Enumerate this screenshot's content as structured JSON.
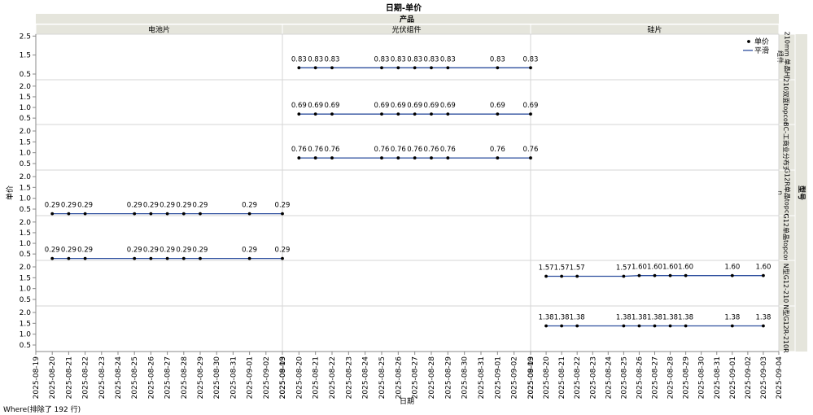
{
  "chart_data": {
    "type": "line",
    "title": "日期-单价",
    "group_header": "产品",
    "row_group_header": "型号",
    "xlabel": "日期",
    "ylabel": "单价",
    "columns": [
      "电池片",
      "光伏组件",
      "硅片"
    ],
    "rows": [
      "210mm 单晶HJT组件",
      "210双面topcon",
      "BC-工商业分布式",
      "G12R单晶topcon",
      "G12单晶topcon",
      "N型G12-210",
      "N型G12R-210R"
    ],
    "x_ticks": [
      "2025-08-19",
      "2025-08-20",
      "2025-08-21",
      "2025-08-22",
      "2025-08-23",
      "2025-08-24",
      "2025-08-25",
      "2025-08-26",
      "2025-08-27",
      "2025-08-28",
      "2025-08-29",
      "2025-08-30",
      "2025-08-31",
      "2025-09-01",
      "2025-09-02",
      "2025-09-03",
      "2025-09-04"
    ],
    "xlim": [
      "2025-08-19",
      "2025-09-03"
    ],
    "xlim_last_panel": [
      "2025-08-19",
      "2025-09-04"
    ],
    "y_axes": [
      {
        "ticks": [
          "2.5",
          "1.5",
          "0.5"
        ],
        "ylim": [
          0.2,
          2.6
        ]
      },
      {
        "ticks": [
          "2.0",
          "1.5",
          "1.0",
          "0.5"
        ],
        "ylim": [
          0.2,
          2.3
        ]
      },
      {
        "ticks": [
          "2.0",
          "1.5",
          "1.0",
          "0.5"
        ],
        "ylim": [
          0.2,
          2.3
        ]
      },
      {
        "ticks": [
          "2.0",
          "1.5",
          "1.0",
          "0.5"
        ],
        "ylim": [
          0.2,
          2.3
        ]
      },
      {
        "ticks": [
          "2.0",
          "1.5",
          "1.0",
          "0.5"
        ],
        "ylim": [
          0.2,
          2.3
        ]
      },
      {
        "ticks": [
          "2.0",
          "1.5",
          "1.0",
          "0.5"
        ],
        "ylim": [
          0.2,
          2.3
        ]
      },
      {
        "ticks": [
          "2.0",
          "1.5",
          "1.0",
          "0.5"
        ],
        "ylim": [
          0.2,
          2.3
        ]
      }
    ],
    "legend": {
      "position": "top-right",
      "points_label": "单价",
      "line_label": "平滑"
    },
    "colors": {
      "points": "#000000",
      "line": "#2e4f9e",
      "grid": "#d6d6d6",
      "header": "#e5e5dc"
    },
    "dates": [
      "2025-08-20",
      "2025-08-21",
      "2025-08-22",
      "2025-08-25",
      "2025-08-26",
      "2025-08-27",
      "2025-08-28",
      "2025-08-29",
      "2025-09-01",
      "2025-09-03"
    ],
    "series": [
      {
        "row": 0,
        "col": 1,
        "values": [
          0.83,
          0.83,
          0.83,
          0.83,
          0.83,
          0.83,
          0.83,
          0.83,
          0.83,
          0.83
        ],
        "labels": [
          "0.83",
          "0.83",
          "0.83",
          "0.83",
          "0.83",
          "0.83",
          "0.83",
          "0.83",
          "0.83",
          "0.83"
        ]
      },
      {
        "row": 1,
        "col": 1,
        "values": [
          0.69,
          0.69,
          0.69,
          0.69,
          0.69,
          0.69,
          0.69,
          0.69,
          0.69,
          0.69
        ],
        "labels": [
          "0.69",
          "0.69",
          "0.69",
          "0.69",
          "0.69",
          "0.69",
          "0.69",
          "0.69",
          "0.69",
          "0.69"
        ]
      },
      {
        "row": 2,
        "col": 1,
        "values": [
          0.76,
          0.76,
          0.76,
          0.76,
          0.76,
          0.76,
          0.76,
          0.76,
          0.76,
          0.76
        ],
        "labels": [
          "0.76",
          "0.76",
          "0.76",
          "0.76",
          "0.76",
          "0.76",
          "0.76",
          "0.76",
          "0.76",
          "0.76"
        ]
      },
      {
        "row": 3,
        "col": 0,
        "values": [
          0.29,
          0.29,
          0.29,
          0.29,
          0.29,
          0.29,
          0.29,
          0.29,
          0.29,
          0.29
        ],
        "labels": [
          "0.29",
          "0.29",
          "0.29",
          "0.29",
          "0.29",
          "0.29",
          "0.29",
          "0.29",
          "0.29",
          "0.29"
        ]
      },
      {
        "row": 4,
        "col": 0,
        "values": [
          0.29,
          0.29,
          0.29,
          0.29,
          0.29,
          0.29,
          0.29,
          0.29,
          0.29,
          0.29
        ],
        "labels": [
          "0.29",
          "0.29",
          "0.29",
          "0.29",
          "0.29",
          "0.29",
          "0.29",
          "0.29",
          "0.29",
          "0.29"
        ]
      },
      {
        "row": 5,
        "col": 2,
        "values": [
          1.57,
          1.57,
          1.57,
          1.57,
          1.6,
          1.6,
          1.6,
          1.6,
          1.6,
          1.6
        ],
        "labels": [
          "1.57",
          "1.57",
          "1.57",
          "1.57",
          "1.60",
          "1.60",
          "1.60",
          "1.60",
          "1.60",
          "1.60"
        ]
      },
      {
        "row": 6,
        "col": 2,
        "values": [
          1.38,
          1.38,
          1.38,
          1.38,
          1.38,
          1.38,
          1.38,
          1.38,
          1.38,
          1.38
        ],
        "labels": [
          "1.38",
          "1.38",
          "1.38",
          "1.38",
          "1.38",
          "1.38",
          "1.38",
          "1.38",
          "1.38",
          "1.38"
        ]
      }
    ],
    "footnote": "Where(排除了 192 行)"
  }
}
